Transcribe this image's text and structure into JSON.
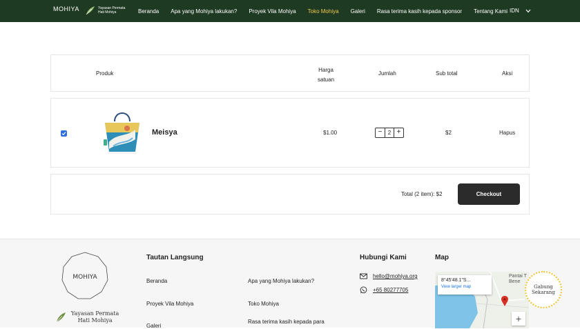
{
  "nav": {
    "logo": "MOHIYA",
    "logo2_line1": "Yayasan Permata",
    "logo2_line2": "Hati Mohiya",
    "links": [
      "Beranda",
      "Apa yang Mohiya lakukan?",
      "Proyek Vila Mohiya",
      "Toko Mohiya",
      "Galeri",
      "Rasa terima kasih kepada sponsor",
      "Tentang Kami"
    ],
    "active_index": 3,
    "lang": "IDN",
    "active_color": "#f2c94c",
    "bg_color": "#1e3a22"
  },
  "cart": {
    "headers": {
      "product": "Produk",
      "unit_price_1": "Harga",
      "unit_price_2": "satuan",
      "qty": "Jumlah",
      "subtotal": "Sub total",
      "action": "Aksi"
    },
    "item": {
      "name": "Meisya",
      "price": "$1.00",
      "qty": "2",
      "qty_minus": "−",
      "qty_plus": "+",
      "subtotal": "$2",
      "remove": "Hapus",
      "checked": true
    },
    "total_label": "Total (2 item): $2",
    "checkout": "Checkout"
  },
  "footer": {
    "logo": "MOHIYA",
    "logo2_line1": "Yayasan Permata",
    "logo2_line2": "Hati Mohiya",
    "quick_links_title": "Tautan Langsung",
    "links_col1": [
      "Beranda",
      "Proyek Vila Mohiya",
      "Galeri"
    ],
    "links_col2": [
      "Apa yang Mohiya lakukan?",
      "Toko Mohiya",
      "Rasa terima kasih kepada para"
    ],
    "contact_title": "Hubungi Kami",
    "email": "hello@mohiya.org",
    "phone": "+65 80277705",
    "map_title": "Map",
    "map_coords": "8°45'48.1\"S...",
    "map_link": "View larger map",
    "map_zoom": "+",
    "map_place": "Pantai T Bene",
    "join": "Gabung Sekarang"
  }
}
